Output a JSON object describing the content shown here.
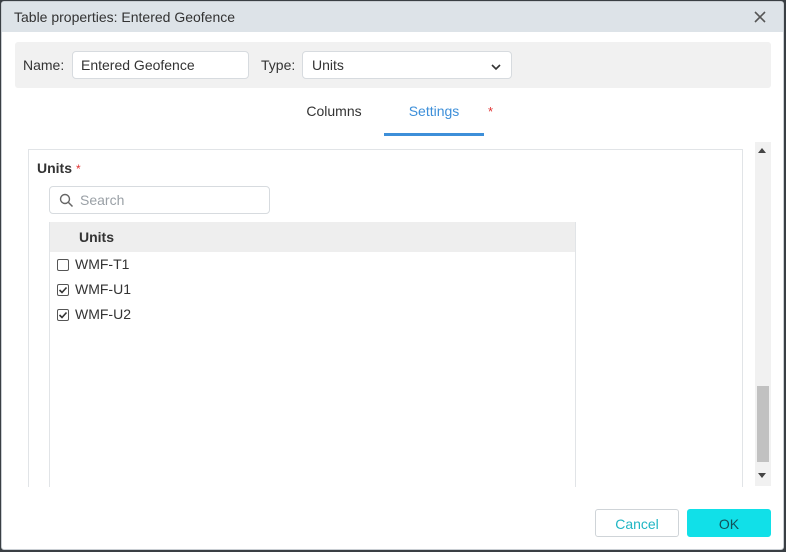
{
  "window": {
    "title": "Table properties: Entered Geofence",
    "close_icon": "close-icon"
  },
  "props": {
    "name_label": "Name:",
    "name_value": "Entered Geofence",
    "type_label": "Type:",
    "type_value": "Units"
  },
  "tabs": [
    {
      "label": "Columns",
      "active": false
    },
    {
      "label": "Settings",
      "active": true
    }
  ],
  "settings_required_mark": "*",
  "units_section": {
    "title": "Units",
    "required_mark": "*",
    "search_placeholder": "Search",
    "column_header": "Units",
    "items": [
      {
        "label": "WMF-T1",
        "checked": false
      },
      {
        "label": "WMF-U1",
        "checked": true
      },
      {
        "label": "WMF-U2",
        "checked": true
      }
    ]
  },
  "footer": {
    "cancel_label": "Cancel",
    "ok_label": "OK"
  },
  "colors": {
    "accent": "#3d8fd9",
    "required": "#e03232",
    "ok_button": "#11e0e8"
  }
}
